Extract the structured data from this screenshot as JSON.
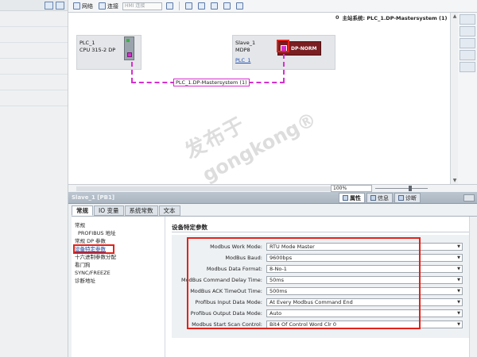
{
  "toolbar": {
    "network_label": "网络",
    "connect_label": "连接",
    "hmi_combo": "HMI 连接"
  },
  "network_header": {
    "number": "0",
    "label": "主站系统: PLC_1.DP-Mastersystem (1)"
  },
  "canvas": {
    "plc": {
      "name": "PLC_1",
      "type": "CPU 315-2 DP"
    },
    "slave": {
      "name": "Slave_1",
      "type": "MDP8",
      "link": "PLC_1",
      "module_label": "DP-NORM"
    },
    "bus_label": "PLC_1.DP-Mastersystem (1)"
  },
  "zoom": {
    "value": "100%"
  },
  "properties": {
    "title": "Slave_1 [PB1]",
    "inspector_tabs": [
      "属性",
      "信息",
      "诊断"
    ],
    "tabs": [
      "常规",
      "IO 变量",
      "系统常数",
      "文本"
    ],
    "nav_items": [
      {
        "label": "常规",
        "level": 1
      },
      {
        "label": "PROFIBUS 地址",
        "level": 2
      },
      {
        "label": "常规 DP 参数",
        "level": 1
      },
      {
        "label": "设备特定参数",
        "level": 1,
        "selected": true
      },
      {
        "label": "十六进制参数分配",
        "level": 1
      },
      {
        "label": "看门狗",
        "level": 1
      },
      {
        "label": "SYNC/FREEZE",
        "level": 1
      },
      {
        "label": "诊断地址",
        "level": 1
      }
    ],
    "section_title": "设备特定参数",
    "params": [
      {
        "label": "Modbus Work Mode:",
        "value": "RTU Mode Master"
      },
      {
        "label": "ModBus Baud:",
        "value": "9600bps"
      },
      {
        "label": "Modbus Data Format:",
        "value": "8-No-1"
      },
      {
        "label": "ModBus Command Delay Time:",
        "value": "50ms"
      },
      {
        "label": "ModBus ACK TimeOut Time:",
        "value": "500ms"
      },
      {
        "label": "Profibus Input Data Mode:",
        "value": "At Every Modbus Command End"
      },
      {
        "label": "Profibus Output Data Mode:",
        "value": "Auto"
      },
      {
        "label": "Modbus Start Scan Control:",
        "value": "Bit4 Of Control Word Clr 0"
      }
    ]
  },
  "watermark": {
    "line1": "发布于",
    "line2": "gongkong®"
  },
  "colors": {
    "highlight_red": "#e2231a",
    "bus_magenta": "#d62fd0",
    "panel_title": "#aab5c1"
  }
}
